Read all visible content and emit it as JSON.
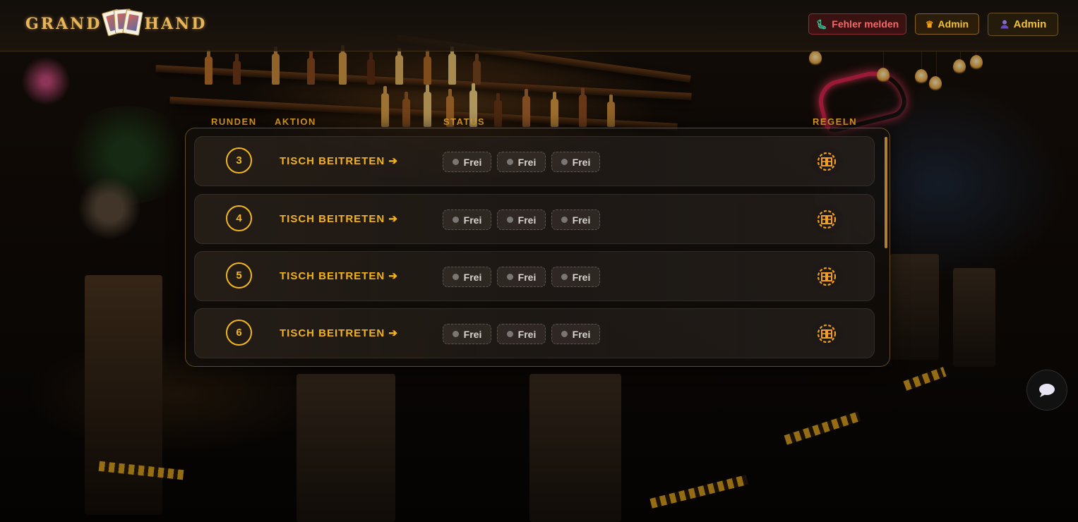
{
  "header": {
    "logo_text_left": "GRAND",
    "logo_text_right": "HAND",
    "report_button": {
      "label": "Fehler melden",
      "icon": "bug-icon"
    },
    "admin_button": {
      "label": "Admin",
      "icon": "crown-icon"
    },
    "user_button": {
      "label": "Admin",
      "icon": "user-icon"
    }
  },
  "columns": {
    "rounds": "RUNDEN",
    "action": "AKTION",
    "status": "STATUS",
    "rules": "REGELN"
  },
  "tables": [
    {
      "rounds": "3",
      "action": "TISCH BEITRETEN ➔",
      "seats": [
        "Frei",
        "Frei",
        "Frei"
      ]
    },
    {
      "rounds": "4",
      "action": "TISCH BEITRETEN ➔",
      "seats": [
        "Frei",
        "Frei",
        "Frei"
      ]
    },
    {
      "rounds": "5",
      "action": "TISCH BEITRETEN ➔",
      "seats": [
        "Frei",
        "Frei",
        "Frei"
      ]
    },
    {
      "rounds": "6",
      "action": "TISCH BEITRETEN ➔",
      "seats": [
        "Frei",
        "Frei",
        "Frei"
      ]
    }
  ],
  "colors": {
    "accent_gold": "#f2b21c",
    "report_red": "#f06a6a",
    "seat_free_dot": "#7a7674"
  },
  "icons": {
    "rules": "rules-book-icon",
    "chat": "chat-bubble-icon"
  }
}
